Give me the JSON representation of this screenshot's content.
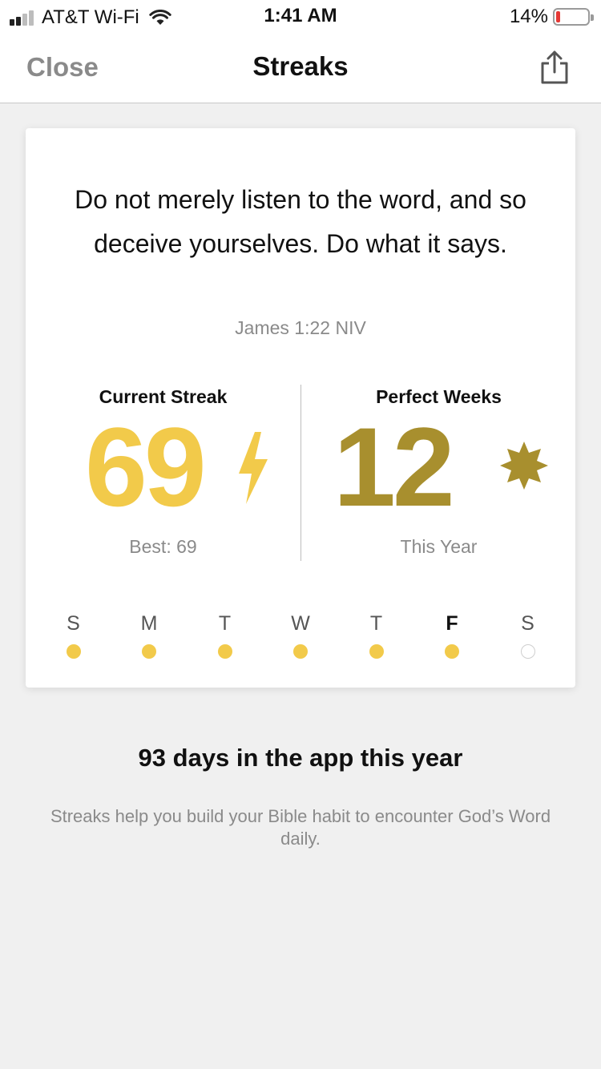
{
  "status_bar": {
    "carrier": "AT&T Wi-Fi",
    "time": "1:41 AM",
    "battery": "14%",
    "battery_level": 0.14,
    "battery_color": "#e53935"
  },
  "nav": {
    "close_label": "Close",
    "title": "Streaks",
    "share_icon": "share-icon"
  },
  "card": {
    "verse": "Do not merely listen to the word, and so deceive yourselves. Do what it says.",
    "reference": "James 1:22 NIV",
    "current_streak": {
      "label": "Current Streak",
      "value": "69",
      "sub": "Best: 69",
      "icon": "lightning-bolt-icon",
      "color": "#f2ca4a"
    },
    "perfect_weeks": {
      "label": "Perfect Weeks",
      "value": "12",
      "sub": "This Year",
      "icon": "star-icon",
      "color": "#a88f2e"
    },
    "week": [
      {
        "letter": "S",
        "filled": true,
        "today": false
      },
      {
        "letter": "M",
        "filled": true,
        "today": false
      },
      {
        "letter": "T",
        "filled": true,
        "today": false
      },
      {
        "letter": "W",
        "filled": true,
        "today": false
      },
      {
        "letter": "T",
        "filled": true,
        "today": false
      },
      {
        "letter": "F",
        "filled": true,
        "today": true
      },
      {
        "letter": "S",
        "filled": false,
        "today": false
      }
    ]
  },
  "summary": {
    "title": "93 days in the app this year",
    "description": "Streaks help you build your Bible habit to encounter God’s Word daily."
  }
}
